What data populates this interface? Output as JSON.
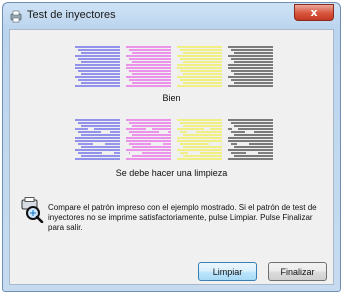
{
  "window": {
    "title": "Test de inyectores",
    "close_label": "x"
  },
  "patterns": {
    "good": {
      "caption": "Bien"
    },
    "bad": {
      "caption": "Se debe hacer una limpieza"
    },
    "colors": [
      "#5a5ae8",
      "#e85ae8",
      "#eeee44",
      "#333333"
    ]
  },
  "message": "Compare el patrón impreso con el ejemplo mostrado. Si el patrón de test de inyectores no se imprime satisfactoriamente, pulse Limpiar. Pulse Finalizar para salir.",
  "buttons": {
    "limpiar": "Limpiar",
    "finalizar": "Finalizar"
  },
  "icons": {
    "title": "printer-icon",
    "info": "printer-magnifier-icon"
  }
}
